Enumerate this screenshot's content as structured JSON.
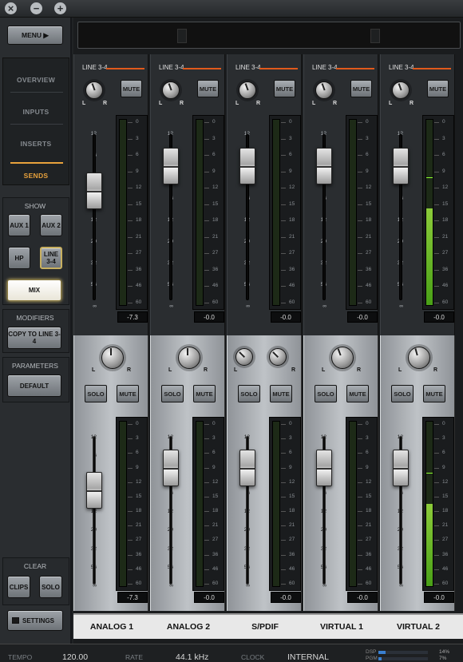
{
  "titlebar": {
    "close": "×",
    "minimize": "−",
    "maximize": "+"
  },
  "sidebar": {
    "menu": "MENU ▶",
    "nav": [
      "OVERVIEW",
      "INPUTS",
      "INSERTS",
      "SENDS"
    ],
    "active_nav": "SENDS",
    "show_header": "SHOW",
    "show_buttons": [
      "AUX 1",
      "AUX 2",
      "HP",
      "LINE 3-4",
      "MIX"
    ],
    "modifiers_header": "MODIFIERS",
    "copy_to": "COPY TO LINE 3-4",
    "parameters_header": "PARAMETERS",
    "default": "DEFAULT",
    "clear_header": "CLEAR",
    "clips": "CLIPS",
    "solo": "SOLO",
    "settings": "SETTINGS"
  },
  "send_strip": {
    "send_label": "LINE 3-4",
    "mute": "MUTE",
    "fader_scale": [
      "12",
      "6",
      "0",
      "6",
      "12",
      "20",
      "32",
      "56",
      "∞"
    ],
    "meter_scale": [
      "0",
      "3",
      "6",
      "9",
      "12",
      "15",
      "18",
      "21",
      "27",
      "36",
      "46",
      "60"
    ],
    "readouts": [
      "-7.3",
      "-0.0",
      "-0.0",
      "-0.0",
      "-0.0"
    ],
    "meter_levels": [
      0,
      0,
      0,
      0,
      0.52
    ],
    "meter_peaks": [
      0,
      0,
      0,
      0,
      0.69
    ],
    "fader_positions": [
      0.15,
      0.0,
      0.0,
      0.0,
      0.0
    ]
  },
  "channels": [
    {
      "name": "ANALOG 1",
      "readout": "-7.3",
      "stereo": false,
      "pan_rotation": [
        0
      ],
      "meter_level": 0,
      "meter_peak": 0,
      "fader_position": 0.15
    },
    {
      "name": "ANALOG 2",
      "readout": "-0.0",
      "stereo": false,
      "pan_rotation": [
        0
      ],
      "meter_level": 0,
      "meter_peak": 0,
      "fader_position": 0.0
    },
    {
      "name": "S/PDIF",
      "readout": "-0.0",
      "stereo": true,
      "pan_rotation": [
        -45,
        -45
      ],
      "meter_level": 0,
      "meter_peak": 0,
      "fader_position": 0.0
    },
    {
      "name": "VIRTUAL 1",
      "readout": "-0.0",
      "stereo": false,
      "pan_rotation": [
        -20
      ],
      "meter_level": 0,
      "meter_peak": 0,
      "fader_position": 0.0
    },
    {
      "name": "VIRTUAL 2",
      "readout": "-0.0",
      "stereo": false,
      "pan_rotation": [
        -15
      ],
      "meter_level": 0.5,
      "meter_peak": 0.69,
      "fader_position": 0.0
    }
  ],
  "channel_buttons": {
    "solo": "SOLO",
    "mute": "MUTE",
    "L": "L",
    "R": "R"
  },
  "status": {
    "tempo_label": "TEMPO",
    "tempo": "120.00",
    "rate_label": "RATE",
    "rate": "44.1 kHz",
    "clock_label": "CLOCK",
    "clock": "INTERNAL",
    "dsp_label": "DSP",
    "dsp_value": "14%",
    "pgm_label": "PGM",
    "pgm_value": "7%"
  },
  "colors": {
    "accent": "#e8a23c",
    "send_line": "#e05a1c",
    "meter_green": "#5ab520"
  }
}
